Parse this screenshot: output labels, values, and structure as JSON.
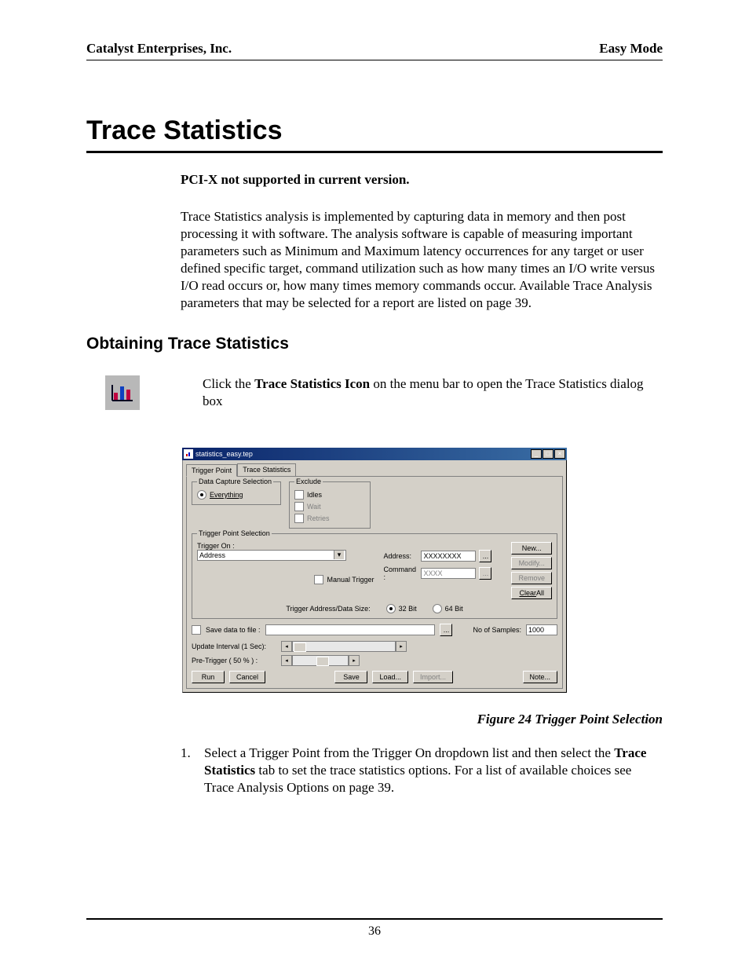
{
  "header": {
    "left": "Catalyst Enterprises, Inc.",
    "right": "Easy Mode"
  },
  "title": "Trace Statistics",
  "note_bold": "PCI-X not supported in current version.",
  "intro_para": "Trace Statistics analysis is implemented by capturing data in memory and then post processing it with software. The analysis software is capable of measuring important parameters such as Minimum and Maximum latency occurrences for any target or user defined specific target, command utilization such as how many times an I/O write versus I/O read occurs or, how many times memory commands occur. Available Trace Analysis parameters that may be selected for a report are listed on page 39.",
  "section_heading": "Obtaining Trace Statistics",
  "instruction_pre": "Click the ",
  "instruction_bold": "Trace Statistics Icon",
  "instruction_post": " on the menu bar to open the Trace Statistics dialog box",
  "dialog": {
    "title": "statistics_easy.tep",
    "tabs": {
      "trigger_point": "Trigger Point",
      "trace_stats": "Trace Statistics"
    },
    "group_data_capture": {
      "title": "Data Capture Selection",
      "everything": "Everything",
      "exclude": "Exclude",
      "idles": "Idles",
      "wait": "Wait",
      "retries": "Retries"
    },
    "group_trigger": {
      "title": "Trigger Point Selection",
      "trigger_on_label": "Trigger On  :",
      "trigger_on_value": "Address",
      "manual_trigger": "Manual Trigger",
      "address_label": "Address:",
      "address_value": "XXXXXXXX",
      "command_label": "Command :",
      "command_value": "XXXX",
      "btn_new": "New...",
      "btn_modify": "Modify...",
      "btn_remove": "Remove",
      "btn_clearall": "Clear All",
      "trig_addr_label": "Trigger Address/Data Size:",
      "r32": "32 Bit",
      "r64": "64 Bit"
    },
    "opts": {
      "save_data": "Save data to file :",
      "update_interval": "Update Interval (1 Sec):",
      "pre_trigger": "Pre-Trigger ( 50 % ) :",
      "samples_label": "No of Samples:",
      "samples_value": "1000"
    },
    "buttons": {
      "run": "Run",
      "cancel": "Cancel",
      "save": "Save",
      "load": "Load...",
      "import": "Import...",
      "note": "Note..."
    }
  },
  "figure_caption": "Figure  24  Trigger Point Selection",
  "step1_num": "1.",
  "step1_pre": "Select a Trigger Point from the Trigger On dropdown list and then select the ",
  "step1_bold": "Trace Statistics",
  "step1_post": " tab to set the trace statistics options. For a list of available choices see Trace Analysis Options on page 39.",
  "page_number": "36"
}
